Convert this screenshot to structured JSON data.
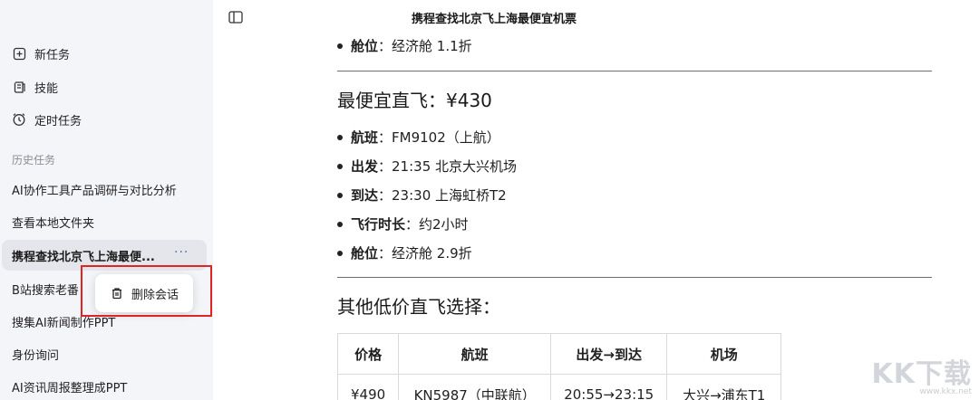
{
  "sidebar": {
    "nav": [
      {
        "label": "新任务",
        "icon": "new-task-icon"
      },
      {
        "label": "技能",
        "icon": "skill-icon"
      },
      {
        "label": "定时任务",
        "icon": "clock-icon"
      }
    ],
    "history_title": "历史任务",
    "history": [
      "AI协作工具产品调研与对比分析",
      "查看本地文件夹",
      "携程查找北京飞上海最便...",
      "B站搜索老番",
      "搜集AI新闻制作PPT",
      "身份询问",
      "AI资讯周报整理成PPT"
    ],
    "active_more": "···",
    "context_menu": {
      "delete_label": "删除会话"
    }
  },
  "header": {
    "title": "携程查找北京飞上海最便宜机票"
  },
  "content": {
    "top_cabin": {
      "key": "舱位",
      "value": "：经济舱 1.1折"
    },
    "cheapest_title": "最便宜直飞：¥430",
    "cheapest_items": [
      {
        "key": "航班",
        "value": "：FM9102（上航）"
      },
      {
        "key": "出发",
        "value": "：21:35 北京大兴机场"
      },
      {
        "key": "到达",
        "value": "：23:30 上海虹桥T2"
      },
      {
        "key": "飞行时长",
        "value": "：约2小时"
      },
      {
        "key": "舱位",
        "value": "：经济舱 2.9折"
      }
    ],
    "others_title": "其他低价直飞选择：",
    "table": {
      "headers": [
        "价格",
        "航班",
        "出发→到达",
        "机场"
      ],
      "rows": [
        [
          "¥490",
          "KN5987（中联航）",
          "20:55→23:15",
          "大兴→浦东T1"
        ]
      ]
    }
  },
  "watermark": {
    "big": "KK下载",
    "small": "www.kkx.net"
  }
}
